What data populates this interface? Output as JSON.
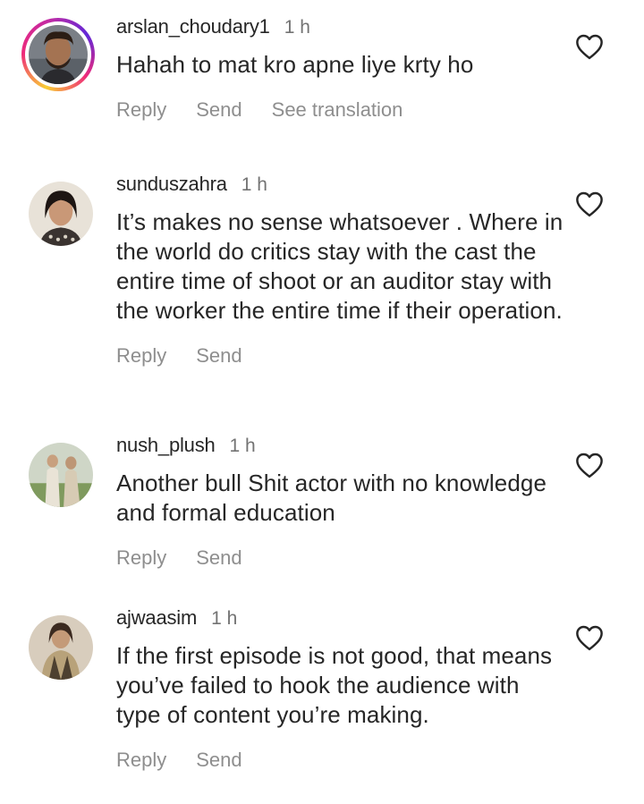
{
  "comments": [
    {
      "username": "arslan_choudary1",
      "time": "1 h",
      "text": "Hahah to mat kro apne liye krty ho",
      "actions": {
        "reply": "Reply",
        "send": "Send",
        "translate": "See translation"
      }
    },
    {
      "username": "sunduszahra",
      "time": "1 h",
      "text": "It’s makes no sense whatsoever . Where in the world do critics stay with the cast the entire time of shoot or an auditor stay with the worker the entire time if their operation.",
      "actions": {
        "reply": "Reply",
        "send": "Send"
      }
    },
    {
      "username": "nush_plush",
      "time": "1 h",
      "text": "Another bull Shit actor with no knowledge and formal education",
      "actions": {
        "reply": "Reply",
        "send": "Send"
      }
    },
    {
      "username": "ajwaasim",
      "time": "1 h",
      "text": "If the first episode is not good, that means you’ve failed to hook the audience with type of content you’re making.",
      "actions": {
        "reply": "Reply",
        "send": "Send"
      }
    }
  ],
  "icons": {
    "like": "heart-outline-icon"
  },
  "colors": {
    "text": "#262626",
    "muted": "#8e8e8e",
    "time": "#737373"
  }
}
